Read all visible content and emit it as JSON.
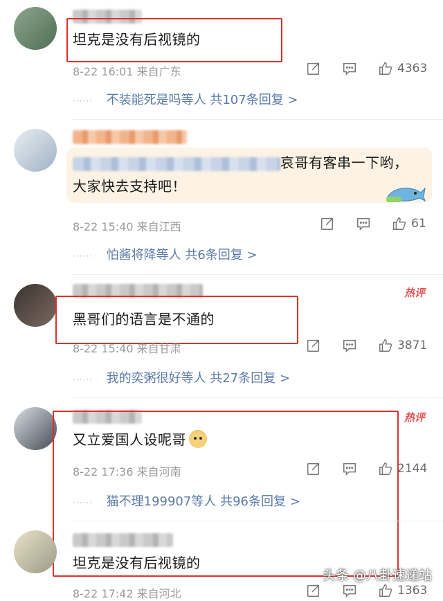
{
  "comments": [
    {
      "text": "坦克是没有后视镜的",
      "time": "8-22 16:01",
      "location": "来自广东",
      "likes": "4363",
      "reply_users": "不装能死是吗等人",
      "reply_count": "共107条回复 >",
      "hot": false
    },
    {
      "text_visible": "哀哥有客串一下哟，",
      "text_line2": "大家快去支持吧！",
      "time": "8-22 15:40",
      "location": "来自江西",
      "likes": "61",
      "reply_users": "怕酱将降等人",
      "reply_count": "共6条回复 >",
      "hot": false
    },
    {
      "text": "黑哥们的语言是不通的",
      "time": "8-22 15:40",
      "location": "来自甘肃",
      "likes": "3871",
      "reply_users": "我的奕粥很好等人",
      "reply_count": "共27条回复 >",
      "hot": true,
      "hot_label": "热评"
    },
    {
      "text": "又立爱国人设呢哥",
      "time": "8-22 17:36",
      "location": "来自河南",
      "likes": "2144",
      "reply_users": "猫不理199907等人",
      "reply_count": "共96条回复 >",
      "hot": true,
      "hot_label": "热评"
    },
    {
      "text": "坦克是没有后视镜的",
      "time": "8-22 17:42",
      "location": "来自河北",
      "likes": "1363"
    }
  ],
  "watermark": "头条 @八卦速递站",
  "accent_colors": {
    "link": "#5a7aa8",
    "hot": "#e45454",
    "highlight_box": "#e0302a"
  },
  "icons": [
    "share-icon",
    "comment-icon",
    "like-icon",
    "doge-emoji-icon",
    "shark-sticker-icon"
  ]
}
